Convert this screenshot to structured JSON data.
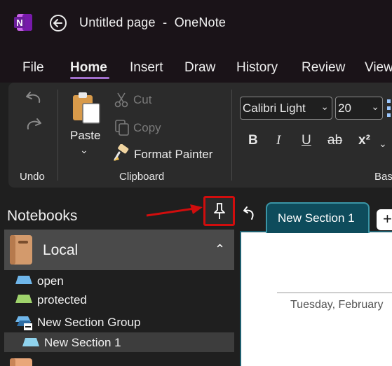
{
  "titlebar": {
    "page_title": "Untitled page",
    "separator": "-",
    "app_name": "OneNote",
    "app_icon_letter": "N"
  },
  "menu": {
    "items": [
      "File",
      "Home",
      "Insert",
      "Draw",
      "History",
      "Review",
      "View"
    ],
    "active": "Home"
  },
  "ribbon": {
    "undo_group_label": "Undo",
    "clipboard": {
      "group_label": "Clipboard",
      "paste_label": "Paste",
      "cut_label": "Cut",
      "copy_label": "Copy",
      "format_painter_label": "Format Painter"
    },
    "basic_text": {
      "group_label": "Bas",
      "font_name": "Calibri Light",
      "font_size": "20",
      "format_buttons": [
        "B",
        "I",
        "U",
        "ab",
        "x²"
      ]
    }
  },
  "notebooks": {
    "title": "Notebooks",
    "notebook_name": "Local",
    "sections": [
      {
        "label": "open",
        "color": "#6fb6ea"
      },
      {
        "label": "protected",
        "color": "#9fd36c"
      }
    ],
    "section_group": "New Section Group",
    "selected_section": {
      "label": "New Section 1",
      "color": "#8fd3ee"
    }
  },
  "tabs": {
    "active_section": "New Section 1",
    "add_label": "+"
  },
  "page": {
    "date_text": "Tuesday, February"
  },
  "colors": {
    "accent_purple": "#a06ecb",
    "tab_teal": "#0e4c5c",
    "highlight_red": "#d10d0d"
  },
  "icons": {
    "app": "onenote-icon",
    "back": "back-arrow-icon",
    "pin": "pin-icon",
    "undo": "undo-icon",
    "redo": "redo-icon",
    "paste": "paste-icon",
    "cut": "scissors-icon",
    "copy": "copy-icon",
    "format_painter": "brush-icon",
    "notebook": "notebook-icon"
  }
}
